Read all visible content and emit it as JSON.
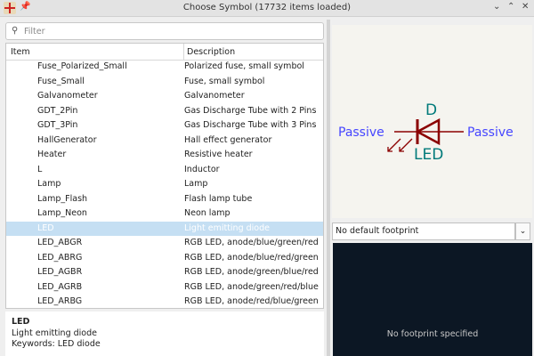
{
  "window": {
    "title": "Choose Symbol (17732 items loaded)",
    "minimize_icon": "chevron-down",
    "maximize_icon": "chevron-up",
    "close_icon": "x"
  },
  "filter": {
    "placeholder": "Filter",
    "value": ""
  },
  "table": {
    "headers": [
      "Item",
      "Description"
    ],
    "rows": [
      {
        "item": "Fuse_Polarized_Small",
        "desc": "Polarized fuse, small symbol"
      },
      {
        "item": "Fuse_Small",
        "desc": "Fuse, small symbol"
      },
      {
        "item": "Galvanometer",
        "desc": "Galvanometer"
      },
      {
        "item": "GDT_2Pin",
        "desc": "Gas Discharge Tube with 2 Pins"
      },
      {
        "item": "GDT_3Pin",
        "desc": "Gas Discharge Tube with 3 Pins"
      },
      {
        "item": "HallGenerator",
        "desc": "Hall effect generator"
      },
      {
        "item": "Heater",
        "desc": "Resistive heater"
      },
      {
        "item": "L",
        "desc": "Inductor"
      },
      {
        "item": "Lamp",
        "desc": "Lamp"
      },
      {
        "item": "Lamp_Flash",
        "desc": "Flash lamp tube"
      },
      {
        "item": "Lamp_Neon",
        "desc": "Neon lamp"
      },
      {
        "item": "LED",
        "desc": "Light emitting diode",
        "selected": true
      },
      {
        "item": "LED_ABGR",
        "desc": "RGB LED, anode/blue/green/red"
      },
      {
        "item": "LED_ABRG",
        "desc": "RGB LED, anode/blue/red/green"
      },
      {
        "item": "LED_AGBR",
        "desc": "RGB LED, anode/green/blue/red"
      },
      {
        "item": "LED_AGRB",
        "desc": "RGB LED, anode/green/red/blue"
      },
      {
        "item": "LED_ARBG",
        "desc": "RGB LED, anode/red/blue/green"
      }
    ]
  },
  "details": {
    "name": "LED",
    "description": "Light emitting diode",
    "keywords": "Keywords: LED diode"
  },
  "symbol": {
    "reference": "D",
    "value": "LED",
    "pin_left": "Passive",
    "pin_right": "Passive",
    "colors": {
      "body": "#8b0000",
      "pin_type": "#4646ff",
      "text": "#007a7a"
    }
  },
  "footprint": {
    "selected": "No default footprint",
    "message": "No footprint specified"
  }
}
